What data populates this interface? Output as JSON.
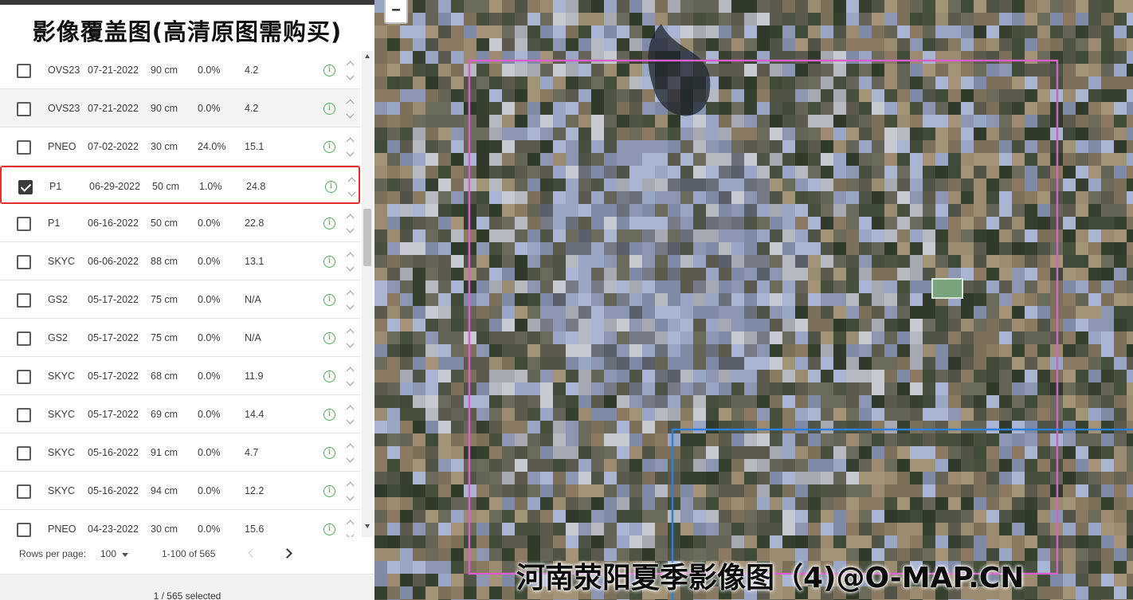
{
  "overlay_title": "影像覆盖图(高清原图需购买)",
  "table": {
    "rows": [
      {
        "satellite": "OVS23",
        "date": "07-21-2022",
        "resolution": "90 cm",
        "cloud": "0.0%",
        "off_nadir": "4.2",
        "checked": false
      },
      {
        "satellite": "OVS23",
        "date": "07-21-2022",
        "resolution": "90 cm",
        "cloud": "0.0%",
        "off_nadir": "4.2",
        "checked": false
      },
      {
        "satellite": "PNEO",
        "date": "07-02-2022",
        "resolution": "30 cm",
        "cloud": "24.0%",
        "off_nadir": "15.1",
        "checked": false
      },
      {
        "satellite": "P1",
        "date": "06-29-2022",
        "resolution": "50 cm",
        "cloud": "1.0%",
        "off_nadir": "24.8",
        "checked": true
      },
      {
        "satellite": "P1",
        "date": "06-16-2022",
        "resolution": "50 cm",
        "cloud": "0.0%",
        "off_nadir": "22.8",
        "checked": false
      },
      {
        "satellite": "SKYC",
        "date": "06-06-2022",
        "resolution": "88 cm",
        "cloud": "0.0%",
        "off_nadir": "13.1",
        "checked": false
      },
      {
        "satellite": "GS2",
        "date": "05-17-2022",
        "resolution": "75 cm",
        "cloud": "0.0%",
        "off_nadir": "N/A",
        "checked": false
      },
      {
        "satellite": "GS2",
        "date": "05-17-2022",
        "resolution": "75 cm",
        "cloud": "0.0%",
        "off_nadir": "N/A",
        "checked": false
      },
      {
        "satellite": "SKYC",
        "date": "05-17-2022",
        "resolution": "68 cm",
        "cloud": "0.0%",
        "off_nadir": "11.9",
        "checked": false
      },
      {
        "satellite": "SKYC",
        "date": "05-17-2022",
        "resolution": "69 cm",
        "cloud": "0.0%",
        "off_nadir": "14.4",
        "checked": false
      },
      {
        "satellite": "SKYC",
        "date": "05-16-2022",
        "resolution": "91 cm",
        "cloud": "0.0%",
        "off_nadir": "4.7",
        "checked": false
      },
      {
        "satellite": "SKYC",
        "date": "05-16-2022",
        "resolution": "94 cm",
        "cloud": "0.0%",
        "off_nadir": "12.2",
        "checked": false
      },
      {
        "satellite": "PNEO",
        "date": "04-23-2022",
        "resolution": "30 cm",
        "cloud": "0.0%",
        "off_nadir": "15.6",
        "checked": false
      }
    ]
  },
  "icons": {
    "info": "info-icon",
    "move_up": "chevron-up-icon",
    "move_down": "chevron-down-icon"
  },
  "info_glyph": "i",
  "pagination": {
    "rows_per_page_label": "Rows per page:",
    "rows_per_page_value": "100",
    "range_label": "1-100 of 565"
  },
  "footer": {
    "selected_count": "1 / 565 selected"
  },
  "map": {
    "zoom_out_label": "−",
    "watermark": "河南荥阳夏季影像图（4)@O-MAP.CN",
    "footprint_colors": {
      "selected": "#d660c9",
      "other": "#2f7fd8"
    }
  },
  "colors": {
    "selection_border": "#e0312b",
    "info_green": "#4caf50"
  }
}
